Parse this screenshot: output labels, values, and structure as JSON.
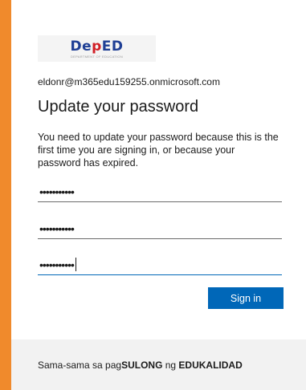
{
  "account": {
    "email": "eldonr@m365edu159255.onmicrosoft.com"
  },
  "logo": {
    "word_left": "De",
    "word_flame": "p",
    "word_right": "ED",
    "tagline": "DEPARTMENT OF EDUCATION"
  },
  "heading": "Update your password",
  "description": "You need to update your password because this is the first time you are signing in, or because your password has expired.",
  "fields": {
    "current_password": "•••••••••••",
    "new_password": "•••••••••••",
    "confirm_password": "•••••••••••"
  },
  "button": {
    "sign_in": "Sign in"
  },
  "footer": {
    "prefix": "Sama-sama sa pag",
    "bold1": "SULONG",
    "middle": " ng ",
    "bold2": "EDUKALIDAD"
  },
  "colors": {
    "accent": "#0067b8",
    "frame": "#f08a2c"
  }
}
